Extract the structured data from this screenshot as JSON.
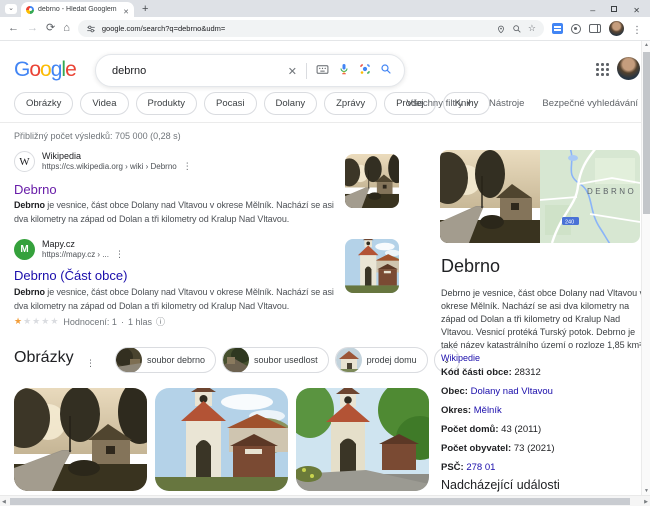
{
  "browser": {
    "tab_title": "debrno - Hledat Googlem",
    "url": "google.com/search?q=debrno&udm="
  },
  "logo": {
    "letters": [
      "G",
      "o",
      "o",
      "g",
      "l",
      "e"
    ]
  },
  "search": {
    "query": "debrno"
  },
  "filters": {
    "chips": [
      "Obrázky",
      "Videa",
      "Produkty",
      "Pocasi",
      "Dolany",
      "Zprávy",
      "Prodej",
      "Knihy"
    ],
    "all_filters": "Všechny filtry",
    "tools": "Nástroje",
    "safe_search": "Bezpečné vyhledávání"
  },
  "results": {
    "stats": "Přibližný počet výsledků: 705 000 (0,28 s)",
    "items": [
      {
        "site": "Wikipedia",
        "breadcrumb": "https://cs.wikipedia.org › wiki › Debrno",
        "title": "Debrno",
        "snippet_bold": "Debrno",
        "snippet": " je vesnice, část obce Dolany nad Vltavou v okrese Mělník. Nachází se asi dva kilometry na západ od Dolan a tři kilometry od Kralup Nad Vltavou."
      },
      {
        "site": "Mapy.cz",
        "breadcrumb": "https://mapy.cz › ...",
        "title": "Debrno (Část obce)",
        "snippet_bold": "Debrno",
        "snippet": " je vesnice, část obce Dolany nad Vltavou v okrese Mělník. Nachází se asi dva kilometry na západ od Dolan a tři kilometry od Kralup Nad Vltavou.",
        "rating_text": "Hodnocení: 1",
        "rating_sep": "·",
        "rating_votes": "1 hlas",
        "rating_stars": 1,
        "rating_max": 5
      }
    ]
  },
  "images_section": {
    "heading": "Obrázky",
    "chips": [
      "soubor debrno",
      "soubor usedlost",
      "prodej domu"
    ]
  },
  "knowledge_panel": {
    "title": "Debrno",
    "map_label": "DEBRNO",
    "road_badge": "240",
    "description": "Debrno je vesnice, část obce Dolany nad Vltavou v okrese Mělník. Nachází se asi dva kilometry na západ od Dolan a tři kilometry od Kralup Nad Vltavou. Vesnicí protéká Turský potok. Debrno je také název katastrálního území o rozloze 1,85 km². ",
    "description_link": "Wikipedie",
    "facts": [
      {
        "label": "Kód části obce:",
        "value": "28312"
      },
      {
        "label": "Obec:",
        "value": "Dolany nad Vltavou"
      },
      {
        "label": "Okres:",
        "value": "Mělník"
      },
      {
        "label": "Počet domů:",
        "value": "43 (2011)"
      },
      {
        "label": "Počet obyvatel:",
        "value": "73 (2021)"
      },
      {
        "label": "PSČ:",
        "value": "278 01"
      }
    ],
    "events_heading": "Nadcházející události"
  },
  "colors": {
    "link_blue": "#1a0dab",
    "visited_purple": "#681da8",
    "brand_blue": "#4285f4",
    "brand_red": "#ea4335",
    "brand_yellow": "#fbbc05",
    "brand_green": "#34a853",
    "star_orange": "#f29d38"
  }
}
